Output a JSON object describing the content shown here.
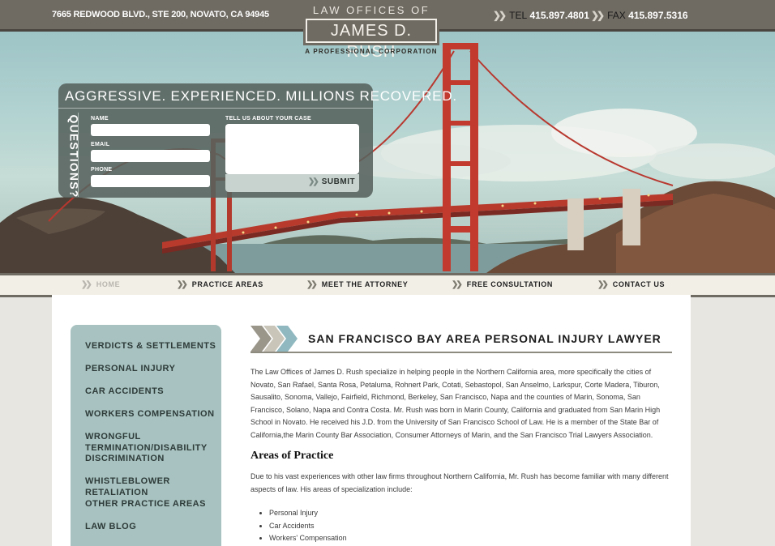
{
  "header": {
    "address": "7665 REDWOOD BLVD., STE 200, NOVATO, CA 94945",
    "tel_label": "TEL",
    "tel_number": "415.897.4801",
    "fax_label": "FAX",
    "fax_number": "415.897.5316"
  },
  "logo": {
    "top": "LAW OFFICES OF",
    "name": "JAMES D. RUSH",
    "sub": "A PROFESSIONAL CORPORATION"
  },
  "hero_form": {
    "slogan": "AGGRESSIVE. EXPERIENCED. MILLIONS RECOVERED.",
    "side_label": "QUESTIONS?",
    "name_label": "NAME",
    "email_label": "EMAIL",
    "phone_label": "PHONE",
    "case_label": "TELL US ABOUT YOUR CASE",
    "submit_label": "SUBMIT"
  },
  "nav": {
    "items": [
      {
        "label": "HOME"
      },
      {
        "label": "PRACTICE AREAS"
      },
      {
        "label": "MEET THE ATTORNEY"
      },
      {
        "label": "FREE CONSULTATION"
      },
      {
        "label": "CONTACT US"
      }
    ]
  },
  "sidebar": {
    "items": [
      {
        "label": "VERDICTS & SETTLEMENTS"
      },
      {
        "label": "PERSONAL INJURY"
      },
      {
        "label": "CAR ACCIDENTS"
      },
      {
        "label": "WORKERS COMPENSATION"
      },
      {
        "label": "WRONGFUL TERMINATION/DISABILITY DISCRIMINATION"
      },
      {
        "label": "WHISTLEBLOWER RETALIATION"
      },
      {
        "label": "OTHER PRACTICE AREAS"
      },
      {
        "label": "LAW BLOG"
      }
    ]
  },
  "main": {
    "title": "SAN FRANCISCO BAY AREA PERSONAL INJURY LAWYER",
    "intro": "The Law Offices of James D. Rush specialize in helping people in the Northern California area, more specifically the cities of Novato, San Rafael, Santa Rosa, Petaluma, Rohnert Park, Cotati, Sebastopol, San Anselmo, Larkspur, Corte Madera, Tiburon, Sausalito, Sonoma, Vallejo, Fairfield, Richmond, Berkeley, San Francisco, Napa and the counties of Marin, Sonoma, San Francisco, Solano, Napa and Contra Costa. Mr. Rush was born in Marin County, California and graduated from San Marin High School in Novato. He received his J.D. from the University of San Francisco School of Law. He is a member of the State Bar of California,the Marin County Bar Association, Consumer Attorneys of Marin, and the San Francisco Trial Lawyers Association.",
    "areas_heading": "Areas of Practice",
    "areas_intro": "Due to his vast experiences with other law firms throughout Northern California, Mr. Rush has become familiar with many different aspects of law. His areas of specialization include:",
    "areas": [
      "Personal Injury",
      "Car Accidents",
      "Workers' Compensation"
    ]
  },
  "colors": {
    "header_bar": "#6f6a62",
    "sidebar": "#a7c2c0",
    "sky": "#9ec4c6",
    "bridge": "#c2392f",
    "accent_chevron": "#8fb8c0"
  }
}
